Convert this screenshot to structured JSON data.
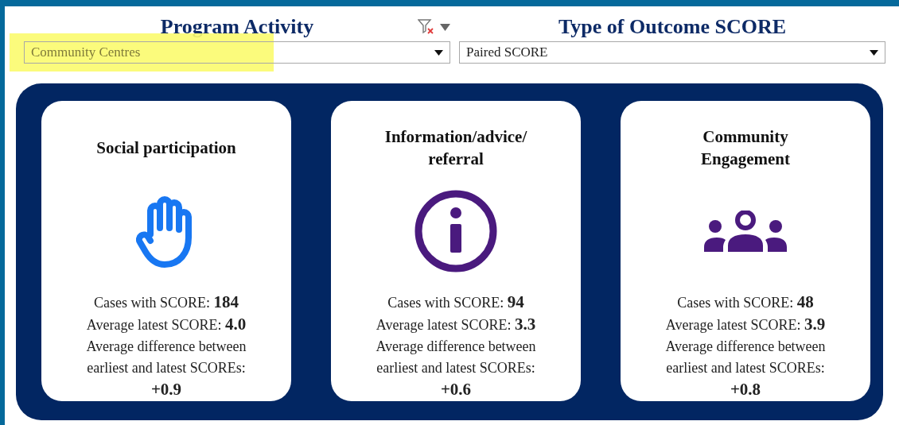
{
  "filters": [
    {
      "title": "Program Activity",
      "value": "Community Centres",
      "highlighted": true,
      "filter_tools": true
    },
    {
      "title": "Type of Outcome SCORE",
      "value": "Paired SCORE",
      "highlighted": false,
      "filter_tools": false
    }
  ],
  "cards": [
    {
      "title": "Social participation",
      "kind": "hand",
      "color": "#1877f2",
      "stats": [
        "Cases with SCORE: **184**",
        "Average latest SCORE: **4.0**",
        "Average difference between earliest and latest SCOREs: **+0.9**"
      ]
    },
    {
      "title": "Information/advice/ referral",
      "kind": "info",
      "color": "#4a1a7e",
      "stats": [
        "Cases with SCORE: **94**",
        "Average latest SCORE: **3.3**",
        "Average difference between earliest and latest SCOREs: **+0.6**"
      ]
    },
    {
      "title": "Community Engagement",
      "kind": "people",
      "color": "#4a1a7e",
      "stats": [
        "Cases with SCORE: **48**",
        "Average latest SCORE: **3.9**",
        "Average difference between earliest and latest SCOREs: **+0.8**"
      ]
    }
  ]
}
